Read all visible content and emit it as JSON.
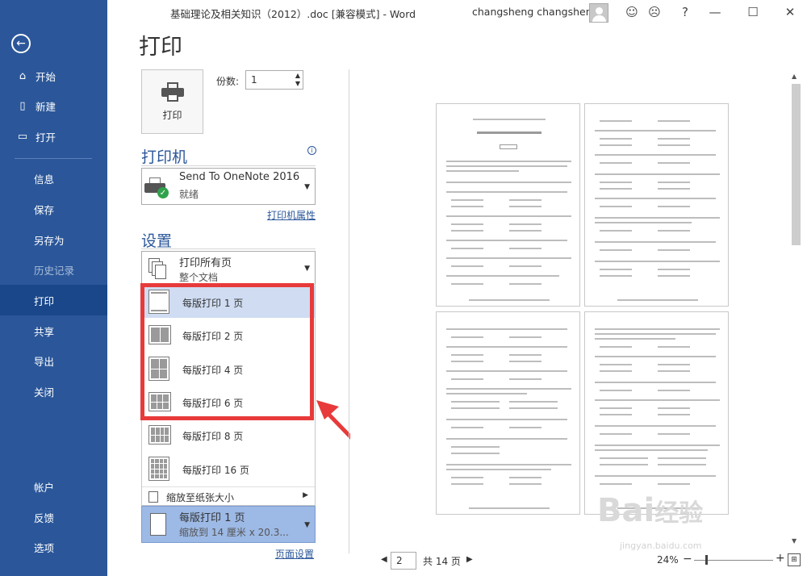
{
  "window": {
    "title": "基础理论及相关知识（2012）.doc [兼容模式] - Word",
    "user": "changsheng changsheng",
    "smile_icon": "smile-icon",
    "frown_icon": "frown-icon",
    "help": "?"
  },
  "sidebar": {
    "items": [
      {
        "label": "开始",
        "icon": "home-icon"
      },
      {
        "label": "新建",
        "icon": "new-doc-icon"
      },
      {
        "label": "打开",
        "icon": "folder-open-icon"
      },
      {
        "label": "信息"
      },
      {
        "label": "保存"
      },
      {
        "label": "另存为"
      },
      {
        "label": "历史记录"
      },
      {
        "label": "打印"
      },
      {
        "label": "共享"
      },
      {
        "label": "导出"
      },
      {
        "label": "关闭"
      },
      {
        "label": "帐户"
      },
      {
        "label": "反馈"
      },
      {
        "label": "选项"
      }
    ]
  },
  "print": {
    "heading": "打印",
    "button_label": "打印",
    "copies_label": "份数:",
    "copies_value": "1"
  },
  "printer": {
    "section_title": "打印机",
    "name": "Send To OneNote 2016",
    "status": "就绪",
    "properties_link": "打印机属性"
  },
  "settings": {
    "section_title": "设置",
    "pages_line1": "打印所有页",
    "pages_line2": "整个文档",
    "dropdown_items": [
      {
        "label": "每版打印 1 页",
        "selected": true
      },
      {
        "label": "每版打印 2 页"
      },
      {
        "label": "每版打印 4 页"
      },
      {
        "label": "每版打印 6 页"
      },
      {
        "label": "每版打印 8 页"
      },
      {
        "label": "每版打印 16 页"
      }
    ],
    "scale_item": "缩放至纸张大小",
    "current_line1": "每版打印 1 页",
    "current_line2": "缩放到 14 厘米 x 20.3...",
    "page_setup_link": "页面设置"
  },
  "status": {
    "page_current": "2",
    "page_total": "共 14 页",
    "zoom": "24%"
  },
  "watermark": {
    "logo": "Bai 经验",
    "url": "jingyan.baidu.com"
  },
  "colors": {
    "sidebar": "#2b579a",
    "highlight": "#e83a3a",
    "selected": "#cfdcf2"
  }
}
